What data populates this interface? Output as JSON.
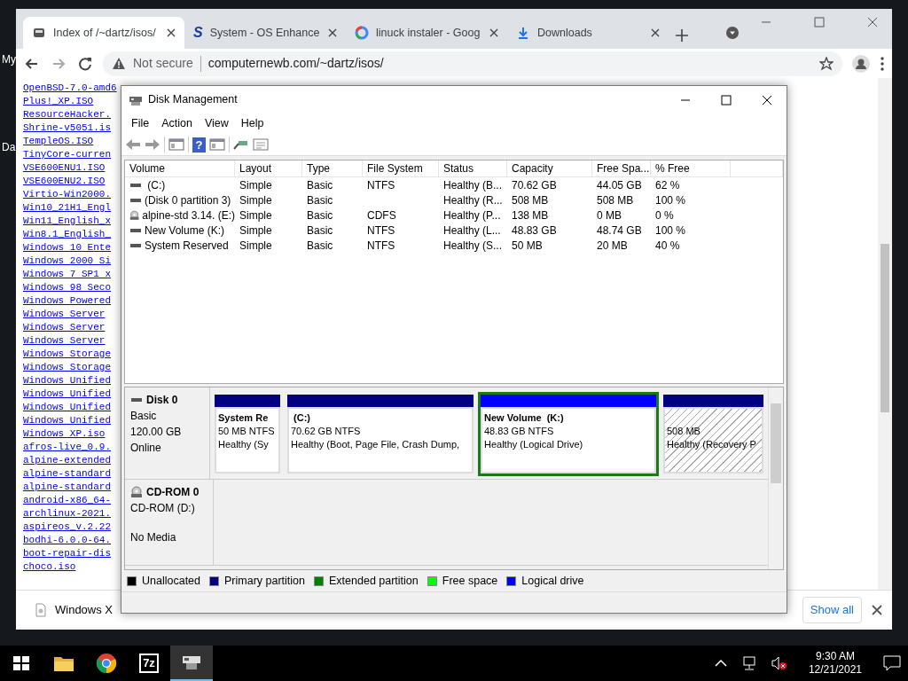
{
  "desktop_labels": [
    "My",
    "Da"
  ],
  "browser": {
    "tabs": [
      {
        "kind": "page",
        "title": "Index of /~dartz/isos/",
        "selected": true
      },
      {
        "kind": "letter",
        "glyph": "S",
        "title": "System - OS Enhance",
        "selected": false
      },
      {
        "kind": "g",
        "title": "linuck instaler - Goog",
        "selected": false
      },
      {
        "kind": "download",
        "title": "Downloads",
        "selected": false
      }
    ],
    "security": "Not secure",
    "url": "computernewb.com/~dartz/isos/",
    "file_links": [
      "OpenBSD-7.0-amd6",
      "Plus!_XP.ISO",
      "ResourceHacker.",
      "Shrine-v5051.is",
      "TempleOS.ISO",
      "TinyCore-curren",
      "VSE600ENU1.ISO",
      "VSE600ENU2.ISO",
      "Virtio-Win2000.",
      "Win10_21H1_Engl",
      "Win11_English_x",
      "Win8.1_English_",
      "Windows 10 Ente",
      "Windows 2000 Si",
      "Windows 7 SP1 x",
      "Windows 98 Seco",
      "Windows Powered",
      "Windows Server",
      "Windows Server",
      "Windows Server",
      "Windows Storage",
      "Windows Storage",
      "Windows Unified",
      "Windows Unified",
      "Windows Unified",
      "Windows Unified",
      "Windows XP.iso",
      "afros-live_0.9.",
      "alpine-extended",
      "alpine-standard",
      "alpine-standard",
      "android-x86_64-",
      "archlinux-2021.",
      "aspireos_v.2.22",
      "bodhi-6.0.0-64.",
      "boot-repair-dis",
      "choco.iso"
    ],
    "downloads": [
      {
        "name": "Windows X"
      }
    ],
    "show_all": "Show all"
  },
  "disk_management": {
    "title": "Disk Management",
    "menu": [
      "File",
      "Action",
      "View",
      "Help"
    ],
    "toolbar": [
      {
        "kind": "back"
      },
      {
        "kind": "forward"
      },
      {
        "kind": "panel"
      },
      {
        "kind": "help",
        "glyph": "?"
      },
      {
        "kind": "panel"
      },
      {
        "kind": "probe"
      },
      {
        "kind": "list"
      }
    ],
    "volume_table": {
      "columns": [
        "Volume",
        "Layout",
        "Type",
        "File System",
        "Status",
        "Capacity",
        "Free Spa...",
        "% Free"
      ],
      "rows": [
        {
          "kind": "disk",
          "cells": [
            " (C:)",
            "Simple",
            "Basic",
            "NTFS",
            "Healthy (B...",
            "70.62 GB",
            "44.05 GB",
            "62 %"
          ]
        },
        {
          "kind": "disk",
          "cells": [
            "(Disk 0 partition 3)",
            "Simple",
            "Basic",
            "",
            "Healthy (R...",
            "508 MB",
            "508 MB",
            "100 %"
          ]
        },
        {
          "kind": "cdrom",
          "cells": [
            "alpine-std 3.14. (E:)",
            "Simple",
            "Basic",
            "CDFS",
            "Healthy (P...",
            "138 MB",
            "0 MB",
            "0 %"
          ]
        },
        {
          "kind": "disk",
          "cells": [
            "New Volume (K:)",
            "Simple",
            "Basic",
            "NTFS",
            "Healthy (L...",
            "48.83 GB",
            "48.74 GB",
            "100 %"
          ]
        },
        {
          "kind": "disk",
          "cells": [
            "System Reserved",
            "Simple",
            "Basic",
            "NTFS",
            "Healthy (S...",
            "50 MB",
            "20 MB",
            "40 %"
          ]
        }
      ]
    },
    "disks": [
      {
        "kind": "disk",
        "name": "Disk 0",
        "lines": [
          "Basic",
          "120.00 GB",
          "Online"
        ],
        "partitions": [
          {
            "name": "System Re",
            "size": "50 MB NTFS",
            "status": "Healthy (Sy",
            "kind": "primary",
            "selected": false,
            "hatched": false
          },
          {
            "name": " (C:)",
            "size": "70.62 GB NTFS",
            "status": "Healthy (Boot, Page File, Crash Dump,",
            "kind": "primary",
            "selected": false,
            "hatched": false
          },
          {
            "name": "New Volume  (K:)",
            "size": "48.83 GB NTFS",
            "status": "Healthy (Logical Drive)",
            "kind": "logical",
            "selected": true,
            "hatched": false
          },
          {
            "size": "508 MB",
            "status": "Healthy (Recovery P",
            "kind": "primary",
            "selected": false,
            "hatched": true
          }
        ]
      },
      {
        "kind": "cdrom",
        "name": "CD-ROM 0",
        "lines": [
          "CD-ROM (D:)"
        ],
        "status": "No Media"
      }
    ],
    "legend": [
      {
        "label": "Unallocated",
        "color": "#000000"
      },
      {
        "label": "Primary partition",
        "color": "#000080"
      },
      {
        "label": "Extended partition",
        "color": "#008000"
      },
      {
        "label": "Free space",
        "color": "#00ff00"
      },
      {
        "label": "Logical drive",
        "color": "#0000ff"
      }
    ]
  },
  "taskbar": {
    "apps": [
      {
        "kind": "folder",
        "selected": false
      },
      {
        "kind": "chrome",
        "selected": false
      },
      {
        "kind": "sevenzip",
        "label": "7z",
        "selected": false
      },
      {
        "kind": "diskmgmt",
        "selected": true
      }
    ],
    "time": "9:30 AM",
    "date": "12/21/2021"
  }
}
